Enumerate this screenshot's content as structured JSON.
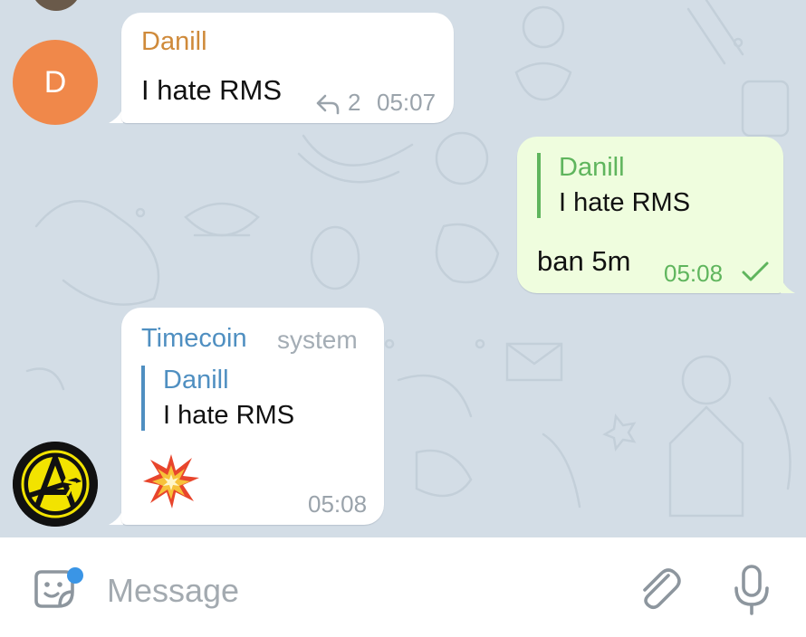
{
  "messages": [
    {
      "sender": "Danill",
      "avatar_letter": "D",
      "text": "I hate RMS",
      "replies": "2",
      "time": "05:07"
    },
    {
      "quote_name": "Danill",
      "quote_text": "I hate RMS",
      "text": "ban 5m",
      "time": "05:08"
    },
    {
      "sender": "Timecoin",
      "badge": "system",
      "quote_name": "Danill",
      "quote_text": "I hate RMS",
      "emoji": "💥",
      "time": "05:08"
    }
  ],
  "composer": {
    "placeholder": "Message"
  },
  "colors": {
    "chat_background": "#d3dde6",
    "danill_name": "#cf8a3a",
    "outgoing_accent": "#5fb55d",
    "timecoin_name": "#4f8fc1",
    "avatar_d": "#f0884a",
    "unread_dot": "#3a95e6"
  },
  "icons": [
    "reply-icon",
    "read-check-icon",
    "sticker-icon",
    "attach-icon",
    "microphone-icon"
  ]
}
